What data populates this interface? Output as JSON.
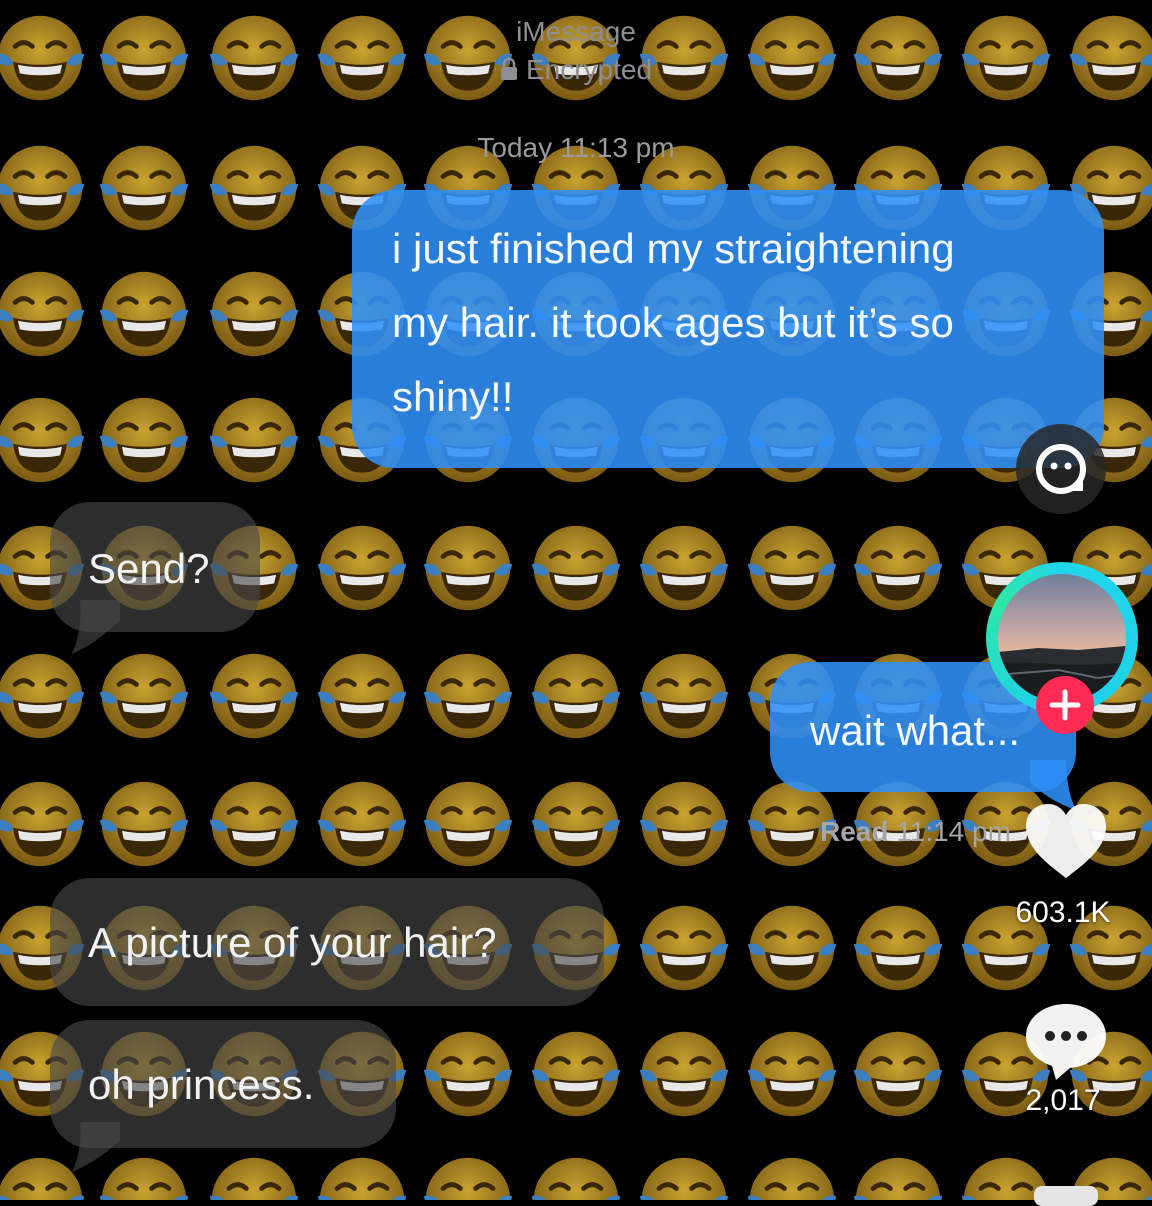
{
  "header": {
    "service": "iMessage",
    "encryption": "Encrypted",
    "timestamp": "Today 11:13 pm"
  },
  "messages": [
    {
      "side": "sent",
      "lines": [
        "i just finished my straightening",
        "my hair. it took ages but it’s so",
        "shiny!!"
      ]
    },
    {
      "side": "received",
      "lines": [
        "Send?"
      ]
    },
    {
      "side": "sent",
      "lines": [
        "wait what..."
      ]
    },
    {
      "side": "received",
      "lines": [
        "A picture of your hair?"
      ]
    },
    {
      "side": "received",
      "lines": [
        "oh princess."
      ]
    }
  ],
  "read_receipt": {
    "label": "Read",
    "time": "11:14 pm"
  },
  "tiktok": {
    "likes": "603.1K",
    "comments": "2,017",
    "icons": [
      "quick-actions-icon",
      "avatar",
      "follow-plus-icon",
      "heart-icon",
      "comment-icon",
      "share-icon"
    ],
    "colors": {
      "accent_red": "#fe2c55",
      "ring": "#20d5ec",
      "sent_bubble": "#2f90f7"
    }
  },
  "background": {
    "pattern_emoji": "face-with-tears-of-joy"
  }
}
